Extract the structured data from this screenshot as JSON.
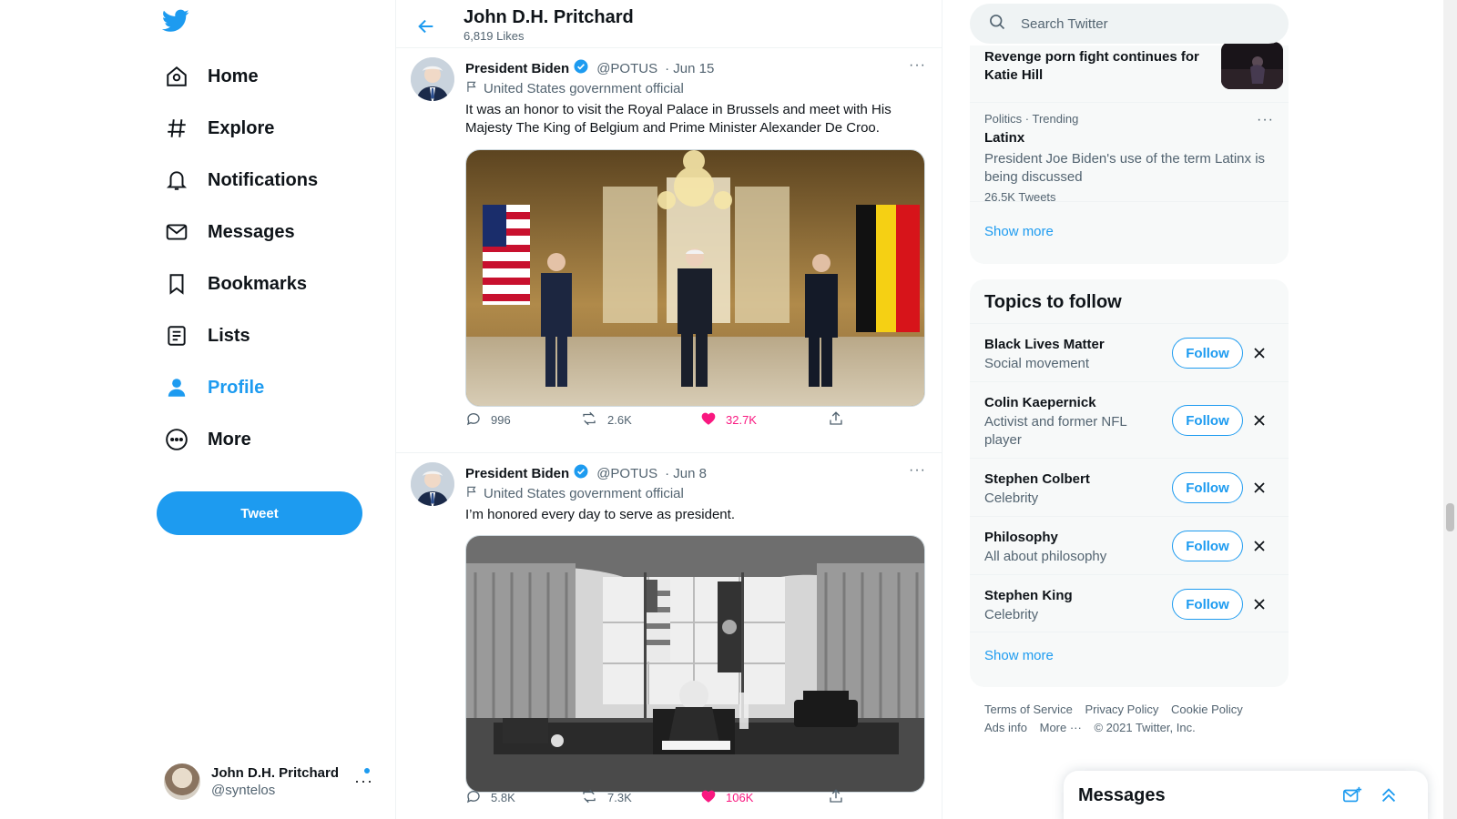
{
  "nav": {
    "items": [
      {
        "label": "Home",
        "icon": "home-icon"
      },
      {
        "label": "Explore",
        "icon": "hashtag-icon"
      },
      {
        "label": "Notifications",
        "icon": "bell-icon"
      },
      {
        "label": "Messages",
        "icon": "envelope-icon"
      },
      {
        "label": "Bookmarks",
        "icon": "bookmark-icon"
      },
      {
        "label": "Lists",
        "icon": "list-icon"
      },
      {
        "label": "Profile",
        "icon": "person-icon"
      },
      {
        "label": "More",
        "icon": "more-circle-icon"
      }
    ],
    "tweet_button": "Tweet",
    "account": {
      "name": "John D.H. Pritchard",
      "handle": "@syntelos"
    }
  },
  "header": {
    "title": "John D.H. Pritchard",
    "subtitle": "6,819 Likes"
  },
  "tweets": [
    {
      "author": "President Biden",
      "handle": "@POTUS",
      "date": "· Jun 15",
      "label": "United States government official",
      "text": "It was an honor to visit the Royal Palace in Brussels and meet with His Majesty The King of Belgium and Prime Minister Alexander De Croo.",
      "replies": "996",
      "retweets": "2.6K",
      "likes": "32.7K"
    },
    {
      "author": "President Biden",
      "handle": "@POTUS",
      "date": "· Jun 8",
      "label": "United States government official",
      "text": "I’m honored every day to serve as president.",
      "replies": "5.8K",
      "retweets": "7.3K",
      "likes": "106K"
    }
  ],
  "search": {
    "placeholder": "Search Twitter"
  },
  "trends": {
    "item1": {
      "title": "Revenge porn fight continues for Katie Hill"
    },
    "item2": {
      "context": "Politics · Trending",
      "title": "Latinx",
      "description": "President Joe Biden's use of the term Latinx is being discussed",
      "count": "26.5K Tweets"
    },
    "show_more": "Show more"
  },
  "topics": {
    "heading": "Topics to follow",
    "items": [
      {
        "name": "Black Lives Matter",
        "desc": "Social movement",
        "button": "Follow"
      },
      {
        "name": "Colin Kaepernick",
        "desc": "Activist and former NFL player",
        "button": "Follow"
      },
      {
        "name": "Stephen Colbert",
        "desc": "Celebrity",
        "button": "Follow"
      },
      {
        "name": "Philosophy",
        "desc": "All about philosophy",
        "button": "Follow"
      },
      {
        "name": "Stephen King",
        "desc": "Celebrity",
        "button": "Follow"
      }
    ],
    "show_more": "Show more"
  },
  "footer": {
    "links": [
      "Terms of Service",
      "Privacy Policy",
      "Cookie Policy",
      "Ads info",
      "More ···"
    ],
    "copyright": "© 2021 Twitter, Inc."
  },
  "messages_drawer": {
    "title": "Messages"
  },
  "colors": {
    "accent": "#1d9bf0",
    "like": "#f91880",
    "text": "#0f1419",
    "muted": "#536471"
  }
}
